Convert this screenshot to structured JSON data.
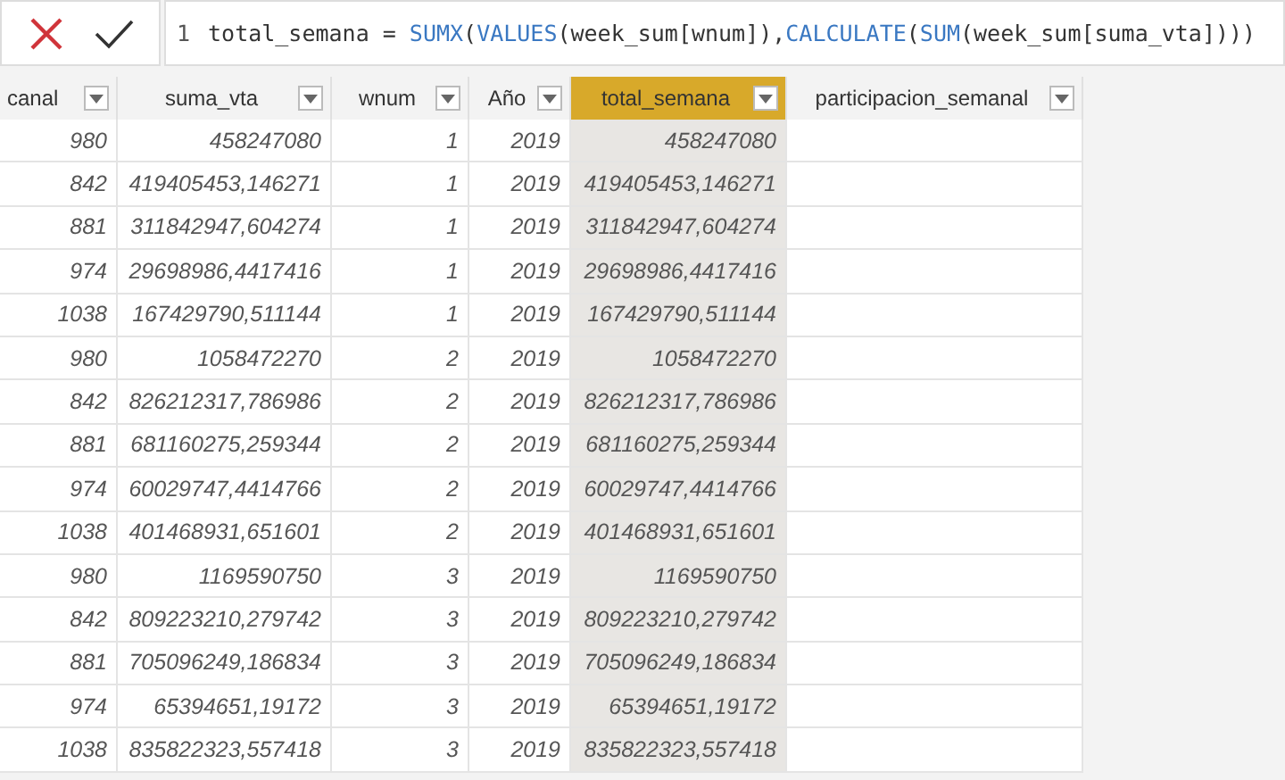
{
  "formula_bar": {
    "line_number": "1",
    "tokens": [
      {
        "text": "total_semana = ",
        "kind": "plain"
      },
      {
        "text": "SUMX",
        "kind": "function"
      },
      {
        "text": "(",
        "kind": "plain"
      },
      {
        "text": "VALUES",
        "kind": "function"
      },
      {
        "text": "(week_sum[wnum]),",
        "kind": "plain"
      },
      {
        "text": "CALCULATE",
        "kind": "function"
      },
      {
        "text": "(",
        "kind": "plain"
      },
      {
        "text": "SUM",
        "kind": "function"
      },
      {
        "text": "(week_sum[suma_vta])))",
        "kind": "plain"
      }
    ]
  },
  "table": {
    "columns": [
      {
        "label": "canal",
        "selected": false
      },
      {
        "label": "suma_vta",
        "selected": false
      },
      {
        "label": "wnum",
        "selected": false
      },
      {
        "label": "Año",
        "selected": false
      },
      {
        "label": "total_semana",
        "selected": true
      },
      {
        "label": "participacion_semanal",
        "selected": false
      }
    ],
    "rows": [
      [
        "980",
        "458247080",
        "1",
        "2019",
        "458247080",
        ""
      ],
      [
        "842",
        "419405453,146271",
        "1",
        "2019",
        "419405453,146271",
        ""
      ],
      [
        "881",
        "311842947,604274",
        "1",
        "2019",
        "311842947,604274",
        ""
      ],
      [
        "974",
        "29698986,4417416",
        "1",
        "2019",
        "29698986,4417416",
        ""
      ],
      [
        "1038",
        "167429790,511144",
        "1",
        "2019",
        "167429790,511144",
        ""
      ],
      [
        "980",
        "1058472270",
        "2",
        "2019",
        "1058472270",
        ""
      ],
      [
        "842",
        "826212317,786986",
        "2",
        "2019",
        "826212317,786986",
        ""
      ],
      [
        "881",
        "681160275,259344",
        "2",
        "2019",
        "681160275,259344",
        ""
      ],
      [
        "974",
        "60029747,4414766",
        "2",
        "2019",
        "60029747,4414766",
        ""
      ],
      [
        "1038",
        "401468931,651601",
        "2",
        "2019",
        "401468931,651601",
        ""
      ],
      [
        "980",
        "1169590750",
        "3",
        "2019",
        "1169590750",
        ""
      ],
      [
        "842",
        "809223210,279742",
        "3",
        "2019",
        "809223210,279742",
        ""
      ],
      [
        "881",
        "705096249,186834",
        "3",
        "2019",
        "705096249,186834",
        ""
      ],
      [
        "974",
        "65394651,19172",
        "3",
        "2019",
        "65394651,19172",
        ""
      ],
      [
        "1038",
        "835822323,557418",
        "3",
        "2019",
        "835822323,557418",
        ""
      ]
    ]
  }
}
